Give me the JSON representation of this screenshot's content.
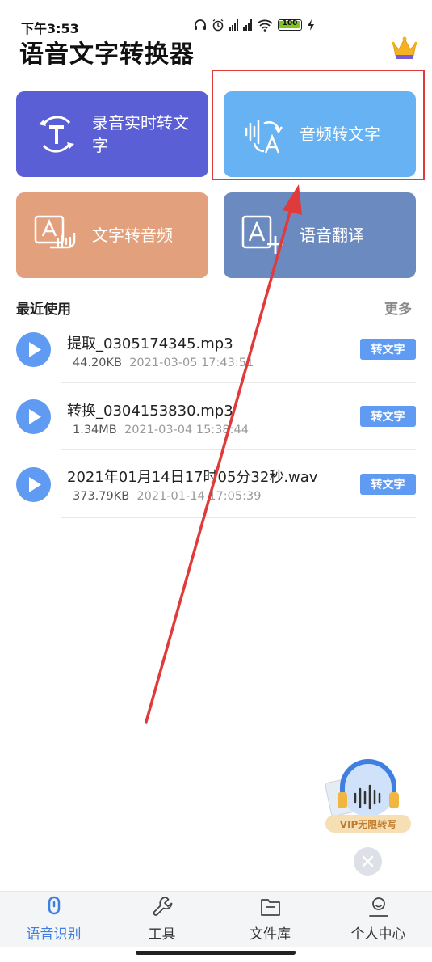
{
  "status_bar": {
    "time": "下午3:53",
    "battery": "100",
    "battery_level": 1.0
  },
  "header": {
    "title": "语音文字转换器",
    "vip_icon": "crown-icon"
  },
  "features": [
    {
      "label": "录音实时转文字",
      "icon": "transcribe-T-icon",
      "color": "#5a5fd6"
    },
    {
      "label": "音频转文字",
      "icon": "audio-to-text-icon",
      "color": "#66b2f2"
    },
    {
      "label": "文字转音频",
      "icon": "text-to-audio-icon",
      "color": "#e3a07d"
    },
    {
      "label": "语音翻译",
      "icon": "translate-icon",
      "color": "#6b8ac0"
    }
  ],
  "recent": {
    "title": "最近使用",
    "more": "更多",
    "items": [
      {
        "name": "提取_0305174345.mp3",
        "size": "44.20KB",
        "date": "2021-03-05 17:43:51",
        "action": "转文字"
      },
      {
        "name": "转换_0304153830.mp3",
        "size": "1.34MB",
        "date": "2021-03-04 15:38:44",
        "action": "转文字"
      },
      {
        "name": "2021年01月14日17时05分32秒.wav",
        "size": "373.79KB",
        "date": "2021-01-14 17:05:39",
        "action": "转文字"
      }
    ]
  },
  "vip_float": {
    "label": "VIP无限转写"
  },
  "bottom_nav": [
    {
      "label": "语音识别",
      "icon": "microphone-icon",
      "active": true
    },
    {
      "label": "工具",
      "icon": "wrench-icon",
      "active": false
    },
    {
      "label": "文件库",
      "icon": "folder-icon",
      "active": false
    },
    {
      "label": "个人中心",
      "icon": "person-icon",
      "active": false
    }
  ],
  "colors": {
    "accent": "#5f9bf2",
    "annotation": "#e03a3a"
  }
}
